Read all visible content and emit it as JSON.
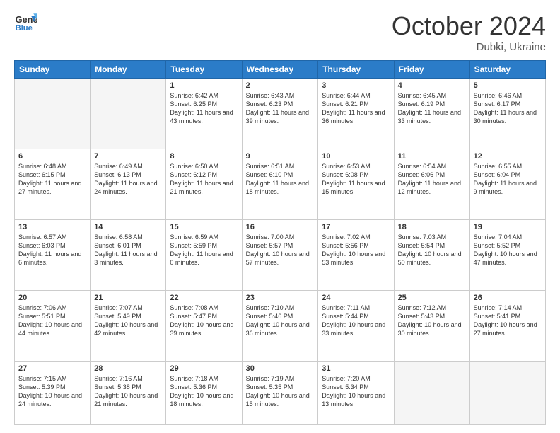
{
  "header": {
    "logo_line1": "General",
    "logo_line2": "Blue",
    "month": "October 2024",
    "location": "Dubki, Ukraine"
  },
  "weekdays": [
    "Sunday",
    "Monday",
    "Tuesday",
    "Wednesday",
    "Thursday",
    "Friday",
    "Saturday"
  ],
  "weeks": [
    [
      {
        "day": "",
        "empty": true
      },
      {
        "day": "",
        "empty": true
      },
      {
        "day": "1",
        "sunrise": "6:42 AM",
        "sunset": "6:25 PM",
        "daylight": "11 hours and 43 minutes."
      },
      {
        "day": "2",
        "sunrise": "6:43 AM",
        "sunset": "6:23 PM",
        "daylight": "11 hours and 39 minutes."
      },
      {
        "day": "3",
        "sunrise": "6:44 AM",
        "sunset": "6:21 PM",
        "daylight": "11 hours and 36 minutes."
      },
      {
        "day": "4",
        "sunrise": "6:45 AM",
        "sunset": "6:19 PM",
        "daylight": "11 hours and 33 minutes."
      },
      {
        "day": "5",
        "sunrise": "6:46 AM",
        "sunset": "6:17 PM",
        "daylight": "11 hours and 30 minutes."
      }
    ],
    [
      {
        "day": "6",
        "sunrise": "6:48 AM",
        "sunset": "6:15 PM",
        "daylight": "11 hours and 27 minutes."
      },
      {
        "day": "7",
        "sunrise": "6:49 AM",
        "sunset": "6:13 PM",
        "daylight": "11 hours and 24 minutes."
      },
      {
        "day": "8",
        "sunrise": "6:50 AM",
        "sunset": "6:12 PM",
        "daylight": "11 hours and 21 minutes."
      },
      {
        "day": "9",
        "sunrise": "6:51 AM",
        "sunset": "6:10 PM",
        "daylight": "11 hours and 18 minutes."
      },
      {
        "day": "10",
        "sunrise": "6:53 AM",
        "sunset": "6:08 PM",
        "daylight": "11 hours and 15 minutes."
      },
      {
        "day": "11",
        "sunrise": "6:54 AM",
        "sunset": "6:06 PM",
        "daylight": "11 hours and 12 minutes."
      },
      {
        "day": "12",
        "sunrise": "6:55 AM",
        "sunset": "6:04 PM",
        "daylight": "11 hours and 9 minutes."
      }
    ],
    [
      {
        "day": "13",
        "sunrise": "6:57 AM",
        "sunset": "6:03 PM",
        "daylight": "11 hours and 6 minutes."
      },
      {
        "day": "14",
        "sunrise": "6:58 AM",
        "sunset": "6:01 PM",
        "daylight": "11 hours and 3 minutes."
      },
      {
        "day": "15",
        "sunrise": "6:59 AM",
        "sunset": "5:59 PM",
        "daylight": "11 hours and 0 minutes."
      },
      {
        "day": "16",
        "sunrise": "7:00 AM",
        "sunset": "5:57 PM",
        "daylight": "10 hours and 57 minutes."
      },
      {
        "day": "17",
        "sunrise": "7:02 AM",
        "sunset": "5:56 PM",
        "daylight": "10 hours and 53 minutes."
      },
      {
        "day": "18",
        "sunrise": "7:03 AM",
        "sunset": "5:54 PM",
        "daylight": "10 hours and 50 minutes."
      },
      {
        "day": "19",
        "sunrise": "7:04 AM",
        "sunset": "5:52 PM",
        "daylight": "10 hours and 47 minutes."
      }
    ],
    [
      {
        "day": "20",
        "sunrise": "7:06 AM",
        "sunset": "5:51 PM",
        "daylight": "10 hours and 44 minutes."
      },
      {
        "day": "21",
        "sunrise": "7:07 AM",
        "sunset": "5:49 PM",
        "daylight": "10 hours and 42 minutes."
      },
      {
        "day": "22",
        "sunrise": "7:08 AM",
        "sunset": "5:47 PM",
        "daylight": "10 hours and 39 minutes."
      },
      {
        "day": "23",
        "sunrise": "7:10 AM",
        "sunset": "5:46 PM",
        "daylight": "10 hours and 36 minutes."
      },
      {
        "day": "24",
        "sunrise": "7:11 AM",
        "sunset": "5:44 PM",
        "daylight": "10 hours and 33 minutes."
      },
      {
        "day": "25",
        "sunrise": "7:12 AM",
        "sunset": "5:43 PM",
        "daylight": "10 hours and 30 minutes."
      },
      {
        "day": "26",
        "sunrise": "7:14 AM",
        "sunset": "5:41 PM",
        "daylight": "10 hours and 27 minutes."
      }
    ],
    [
      {
        "day": "27",
        "sunrise": "7:15 AM",
        "sunset": "5:39 PM",
        "daylight": "10 hours and 24 minutes."
      },
      {
        "day": "28",
        "sunrise": "7:16 AM",
        "sunset": "5:38 PM",
        "daylight": "10 hours and 21 minutes."
      },
      {
        "day": "29",
        "sunrise": "7:18 AM",
        "sunset": "5:36 PM",
        "daylight": "10 hours and 18 minutes."
      },
      {
        "day": "30",
        "sunrise": "7:19 AM",
        "sunset": "5:35 PM",
        "daylight": "10 hours and 15 minutes."
      },
      {
        "day": "31",
        "sunrise": "7:20 AM",
        "sunset": "5:34 PM",
        "daylight": "10 hours and 13 minutes."
      },
      {
        "day": "",
        "empty": true
      },
      {
        "day": "",
        "empty": true
      }
    ]
  ]
}
